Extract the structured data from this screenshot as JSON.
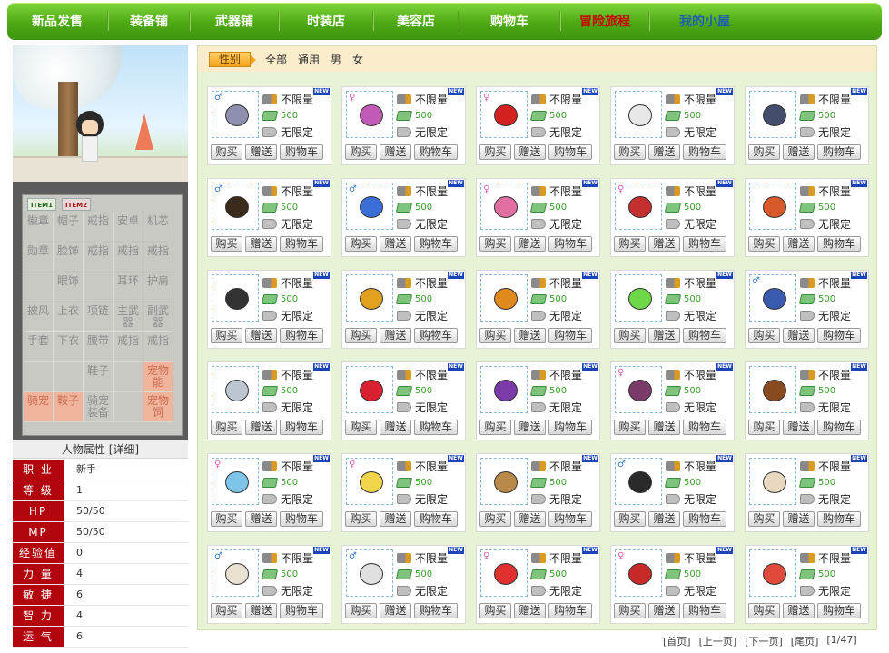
{
  "nav": {
    "items": [
      {
        "label": "新品发售",
        "style": "normal"
      },
      {
        "label": "装备铺",
        "style": "normal"
      },
      {
        "label": "武器铺",
        "style": "normal"
      },
      {
        "label": "时装店",
        "style": "normal"
      },
      {
        "label": "美容店",
        "style": "normal"
      },
      {
        "label": "购物车",
        "style": "normal"
      },
      {
        "label": "冒险旅程",
        "style": "red"
      },
      {
        "label": "我的小屋",
        "style": "blue"
      }
    ]
  },
  "equipment": {
    "tabs": [
      "ITEM1",
      "ITEM2"
    ],
    "cells": [
      "徽章",
      "帽子",
      "戒指",
      "安卓",
      "机芯",
      "勋章",
      "脸饰",
      "戒指",
      "戒指",
      "戒指",
      "",
      "眼饰",
      "",
      "耳环",
      "护肩",
      "披风",
      "上衣",
      "项链",
      "主武器",
      "副武器",
      "手套",
      "下衣",
      "腰带",
      "戒指",
      "戒指",
      "",
      "",
      "鞋子",
      "",
      "宠物能",
      "骑宠",
      "鞍子",
      "骑宠装备",
      "",
      "宠物饲"
    ]
  },
  "attributes": {
    "title": "人物属性 [详细]",
    "rows": [
      {
        "label": "职 业",
        "value": "新手"
      },
      {
        "label": "等 级",
        "value": "1"
      },
      {
        "label": "HP",
        "value": "50/50"
      },
      {
        "label": "MP",
        "value": "50/50"
      },
      {
        "label": "经验值",
        "value": "0"
      },
      {
        "label": "力 量",
        "value": "4"
      },
      {
        "label": "敏 捷",
        "value": "6"
      },
      {
        "label": "智 力",
        "value": "4"
      },
      {
        "label": "运 气",
        "value": "6"
      }
    ]
  },
  "filter": {
    "label": "性别",
    "options": [
      "全部",
      "通用",
      "男",
      "女"
    ]
  },
  "item_common": {
    "badge": "NEW",
    "stock": "不限量",
    "price": "500",
    "limit": "无限定",
    "buy": "购买",
    "gift": "赠送",
    "cart": "购物车"
  },
  "items": [
    {
      "gender": "♂",
      "color": "#8f8fb0",
      "icon": "scarf-icon"
    },
    {
      "gender": "♀",
      "color": "#c25bb8",
      "icon": "scarf-icon"
    },
    {
      "gender": "♀",
      "color": "#d42020",
      "icon": "bikini-icon"
    },
    {
      "gender": "",
      "color": "#e8e8e8",
      "icon": "scroll-icon"
    },
    {
      "gender": "",
      "color": "#444d6b",
      "icon": "mask-icon"
    },
    {
      "gender": "♂",
      "color": "#3a2a1a",
      "icon": "hair-icon"
    },
    {
      "gender": "♂",
      "color": "#3a6fd8",
      "icon": "cap-icon"
    },
    {
      "gender": "♀",
      "color": "#e26fa2",
      "icon": "hat-icon"
    },
    {
      "gender": "♀",
      "color": "#c42f2f",
      "icon": "helmet-icon"
    },
    {
      "gender": "",
      "color": "#d85a2a",
      "icon": "bugs-icon"
    },
    {
      "gender": "",
      "color": "#333333",
      "icon": "hair-icon"
    },
    {
      "gender": "",
      "color": "#e0a21e",
      "icon": "tech-hat-icon"
    },
    {
      "gender": "",
      "color": "#e08a1e",
      "icon": "straw-hat-icon"
    },
    {
      "gender": "",
      "color": "#6fd84a",
      "icon": "slime-hat-icon"
    },
    {
      "gender": "♂",
      "color": "#3a5ab0",
      "icon": "pants-icon"
    },
    {
      "gender": "",
      "color": "#bcc6d2",
      "icon": "pants-icon"
    },
    {
      "gender": "",
      "color": "#d82030",
      "icon": "sock-icon"
    },
    {
      "gender": "",
      "color": "#7a3aa8",
      "icon": "boot-icon"
    },
    {
      "gender": "♀",
      "color": "#7a3a6a",
      "icon": "boots-icon"
    },
    {
      "gender": "",
      "color": "#8a4a20",
      "icon": "bear-icon"
    },
    {
      "gender": "♀",
      "color": "#7ec4e8",
      "icon": "shirt-icon"
    },
    {
      "gender": "♀",
      "color": "#f0d44a",
      "icon": "shirt-icon"
    },
    {
      "gender": "",
      "color": "#b88a4a",
      "icon": "shell-icon"
    },
    {
      "gender": "♂",
      "color": "#2a2a2a",
      "icon": "ring-icon"
    },
    {
      "gender": "",
      "color": "#e8d8c0",
      "icon": "face-card-icon"
    },
    {
      "gender": "♂",
      "color": "#e8e0d0",
      "icon": "beard-card-icon"
    },
    {
      "gender": "♂",
      "color": "#e0e0e0",
      "icon": "orb-card-icon"
    },
    {
      "gender": "♀",
      "color": "#e03030",
      "icon": "feather-card-icon"
    },
    {
      "gender": "♀",
      "color": "#c82a2a",
      "icon": "heart-card-icon"
    },
    {
      "gender": "",
      "color": "#e04a3a",
      "icon": "feather-card-icon"
    }
  ],
  "pager": {
    "first": "[首页]",
    "prev": "[上一页]",
    "next": "[下一页]",
    "last": "[尾页]",
    "current": "[1/47]"
  }
}
